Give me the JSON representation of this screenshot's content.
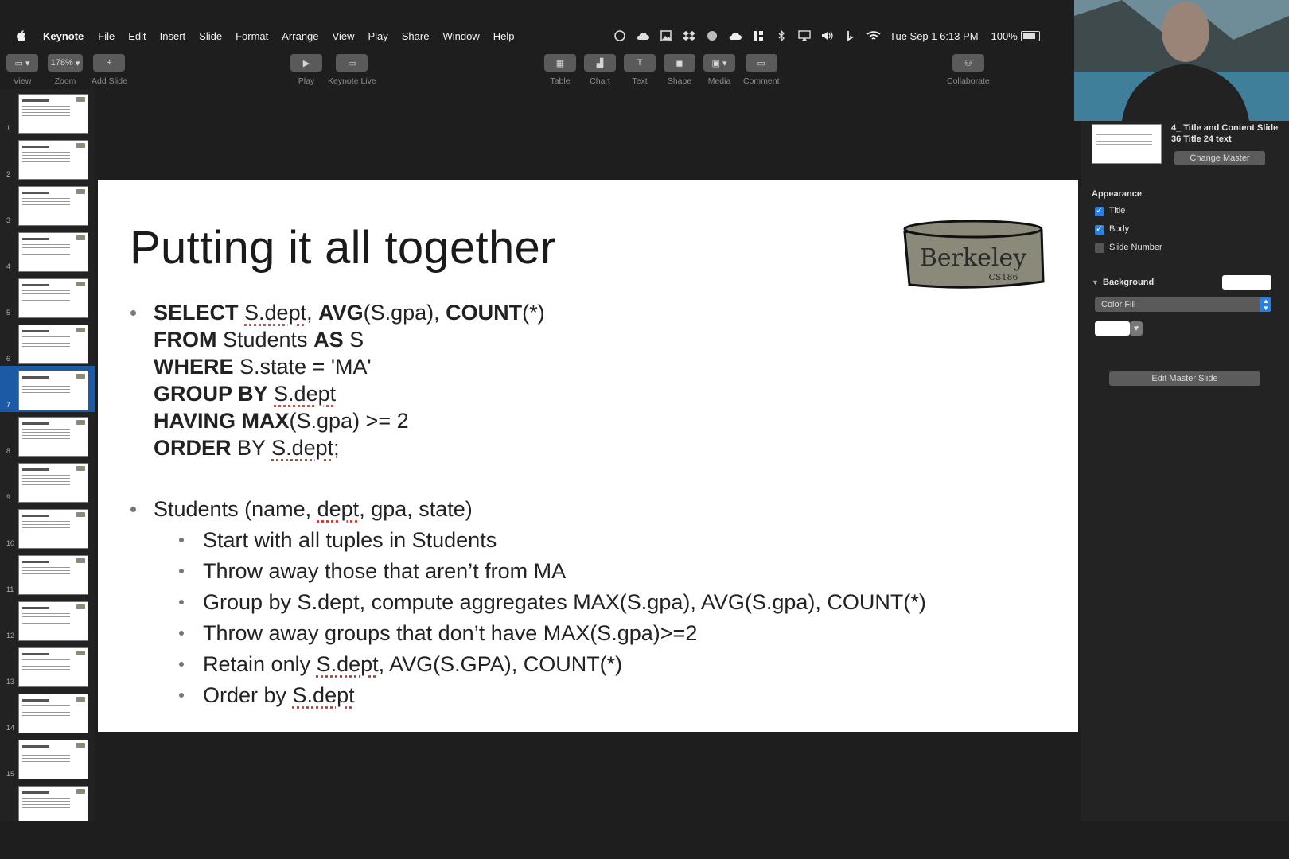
{
  "menubar": {
    "app_name": "Keynote",
    "items": [
      "File",
      "Edit",
      "Insert",
      "Slide",
      "Format",
      "Arrange",
      "View",
      "Play",
      "Share",
      "Window",
      "Help"
    ],
    "datetime": "Tue Sep 1  6:13 PM",
    "battery": "100%"
  },
  "toolbar": {
    "view": "View",
    "zoom": "Zoom",
    "zoom_value": "178%",
    "add_slide": "Add Slide",
    "play": "Play",
    "keynote_live": "Keynote Live",
    "table": "Table",
    "chart": "Chart",
    "text": "Text",
    "shape": "Shape",
    "media": "Media",
    "comment": "Comment",
    "collaborate": "Collaborate"
  },
  "navigator": {
    "slide_numbers": [
      "1",
      "2",
      "3",
      "4",
      "5",
      "6",
      "7",
      "8",
      "9",
      "10",
      "11",
      "12",
      "13",
      "14",
      "15"
    ],
    "selected": "7"
  },
  "slide": {
    "title": "Putting it all together",
    "sql": {
      "l1_kw1": "SELECT",
      "l1_t1": " ",
      "l1_u1": "S.dept",
      "l1_t2": ", ",
      "l1_kw2": "AVG",
      "l1_t3": "(S.gpa), ",
      "l1_kw3": "COUNT",
      "l1_t4": "(*)",
      "l2_kw": "FROM",
      "l2_t1": " Students ",
      "l2_kw2": "AS",
      "l2_t2": " S",
      "l3_kw": "WHERE",
      "l3_t": " S.state = 'MA'",
      "l4_kw": "GROUP BY",
      "l4_sp": " ",
      "l4_u": "S.dept",
      "l5_kw": "HAVING MAX",
      "l5_t": "(S.gpa) >= 2",
      "l6_kw": "ORDER",
      "l6_t": " BY ",
      "l6_u": "S.dept",
      "l6_end": ";"
    },
    "students_pre": "Students (name, ",
    "students_u": "dept",
    "students_post": ", gpa, state)",
    "steps": [
      "Start with all tuples in Students",
      "Throw away those that aren’t from MA",
      "Group by S.dept, compute aggregates MAX(S.gpa), AVG(S.gpa), COUNT(*)",
      "Throw away groups that don’t have MAX(S.gpa)>=2"
    ],
    "step5_pre": "Retain only ",
    "step5_u": "S.dept",
    "step5_post": ", AVG(S.GPA), COUNT(*)",
    "step6_pre": "Order by ",
    "step6_u": "S.dept",
    "logo_text": "Berkeley",
    "logo_sub": "CS186"
  },
  "inspector": {
    "master_name": "4_ Title and Content Slide 36 Title 24 text",
    "change_master": "Change Master",
    "appearance": "Appearance",
    "title_label": "Title",
    "body_label": "Body",
    "slide_number_label": "Slide Number",
    "background": "Background",
    "fill_type": "Color Fill",
    "edit_master": "Edit Master Slide",
    "checks": {
      "title": true,
      "body": true,
      "slide_number": false
    }
  },
  "colors": {
    "selection": "#1c5aa6",
    "accent": "#2a7fe0",
    "logo_fill": "#8b8a7a"
  }
}
